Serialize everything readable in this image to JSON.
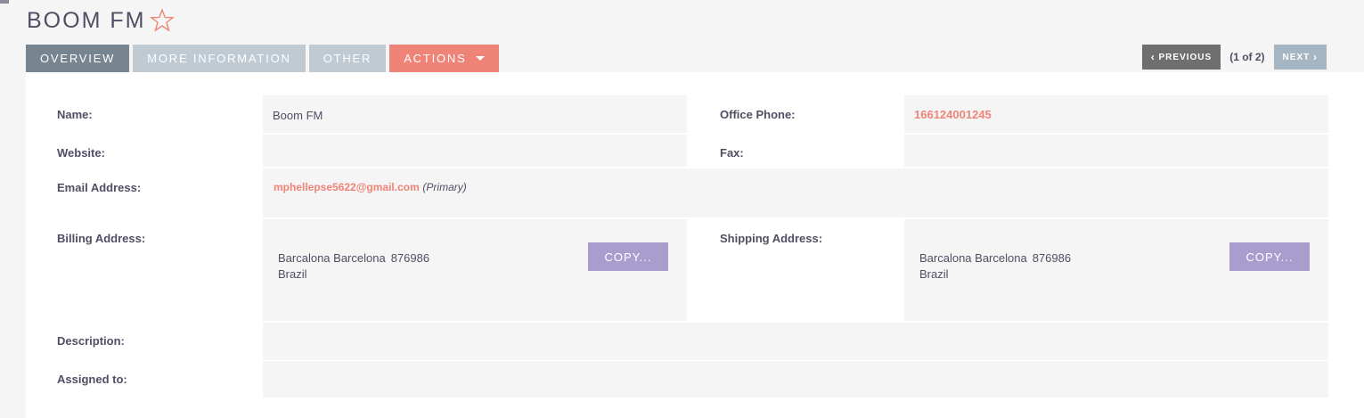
{
  "header": {
    "title": "BOOM FM",
    "favorite_icon": "star-outline-icon"
  },
  "tabs": [
    {
      "label": "OVERVIEW",
      "active": true
    },
    {
      "label": "MORE INFORMATION"
    },
    {
      "label": "OTHER"
    },
    {
      "label": "ACTIONS"
    }
  ],
  "pager": {
    "prev_label": "PREVIOUS",
    "count": "(1 of 2)",
    "next_label": "NEXT"
  },
  "fields": {
    "name_label": "Name:",
    "name_value": "Boom FM",
    "office_phone_label": "Office Phone:",
    "office_phone_value": "166124001245",
    "website_label": "Website:",
    "website_value": "",
    "fax_label": "Fax:",
    "fax_value": "",
    "email_label": "Email Address:",
    "email_value": "mphellepse5622@gmail.com",
    "email_primary": "(Primary)",
    "billing_label": "Billing Address:",
    "billing_street": "Barcalona Barcelona",
    "billing_zip": "876986",
    "billing_country": "Brazil",
    "shipping_label": "Shipping Address:",
    "shipping_street": "Barcalona Barcelona",
    "shipping_zip": "876986",
    "shipping_country": "Brazil",
    "copy_label": "COPY...",
    "description_label": "Description:",
    "description_value": "",
    "assigned_label": "Assigned to:",
    "assigned_value": ""
  },
  "colors": {
    "accent": "#f08377",
    "tab_active": "#778591",
    "tab_inactive": "#bfcad3",
    "copy_button": "#a99dcd"
  }
}
